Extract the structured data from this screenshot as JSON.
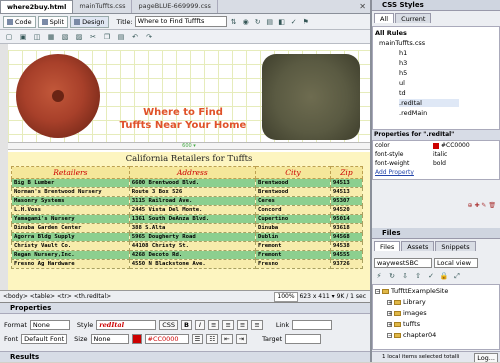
{
  "doc_tabs": [
    "where2buy.html",
    "mainTuffts.css",
    "pageBLUE-669999.css"
  ],
  "toolbar": {
    "code": "Code",
    "split": "Split",
    "design": "Design",
    "title_label": "Title:",
    "title_value": "Where to Find Tufffts"
  },
  "ruler_width": "600 ▾",
  "headline": [
    "Where to Find",
    "Tuffts Near Your Home"
  ],
  "table": {
    "title": "California Retailers for Tuffts",
    "headers": [
      "Retailers",
      "Address",
      "City",
      "Zip"
    ],
    "rows": [
      [
        "Big B Lumber",
        "6600 Brentwood Blvd.",
        "Brentwood",
        "94513"
      ],
      [
        "Norman's Brentwood Nursery",
        "Route 3 Box 526",
        "Brentwood",
        "94513"
      ],
      [
        "Masonry Systems",
        "3115 Railroad Ave.",
        "Ceres",
        "95307"
      ],
      [
        "L.H.Voss",
        "2445 Vista Del Monte.",
        "Concord",
        "94520"
      ],
      [
        "Yamagami's Nursery",
        "1361 South DeAnza Blvd.",
        "Cupertino",
        "95014"
      ],
      [
        "Dinuba Garden Center",
        "388 S.Alta",
        "Dinuba",
        "93618"
      ],
      [
        "Agorra Bldg Supply",
        "5965 Dougherty Road",
        "Dublin",
        "94568"
      ],
      [
        "Christy Vault Co.",
        "44108 Christy St.",
        "Fremont",
        "94538"
      ],
      [
        "Regan Nursery,Inc.",
        "4268 Decoto Rd.",
        "Fremont",
        "94555"
      ],
      [
        "Fresno Ag Hardware",
        "4550 N Blackstone Ave.",
        "Fresno",
        "93726"
      ]
    ]
  },
  "status": {
    "path": "<body> <table> <tr> <th.redItal>",
    "zoom": "100%",
    "info": "623 x 411 ▾ 9K / 1 sec"
  },
  "properties": {
    "title": "Properties",
    "format_label": "Format",
    "format_value": "None",
    "style_label": "Style",
    "style_value": "redItal",
    "css_btn": "CSS",
    "bold_btn": "B",
    "italic_btn": "I",
    "link_label": "Link",
    "font_label": "Font",
    "font_value": "Default Font",
    "size_label": "Size",
    "size_value": "None",
    "color_value": "#CC0000",
    "target_label": "Target",
    "results": "Results"
  },
  "css_panel": {
    "title": "CSS Styles",
    "tab_all": "All",
    "tab_current": "Current",
    "all_rules": "All Rules",
    "file": "mainTuffts.css",
    "rules": [
      "h1",
      "h3",
      "h5",
      "ul",
      "td",
      ".redItal",
      ".redMain"
    ],
    "props_for": "Properties for \".redItal\"",
    "props": [
      {
        "name": "color",
        "value": "#CC0000"
      },
      {
        "name": "font-style",
        "value": "italic"
      },
      {
        "name": "font-weight",
        "value": "bold"
      }
    ],
    "add_property": "Add Property"
  },
  "files_panel": {
    "title": "Files",
    "tabs": [
      "Files",
      "Assets",
      "Snippets"
    ],
    "site": "waywestSBC",
    "view": "Local view",
    "tree": [
      "TuffttExampleSite",
      "Library",
      "images",
      "tuffts",
      "chapter04"
    ],
    "status": "1 local items selected totalli",
    "log": "Log..."
  },
  "colors": {
    "accent": "#CC0000",
    "headline": "#e0522a",
    "row_green": "#8ccf8f",
    "row_yellow": "#f7ecac"
  }
}
